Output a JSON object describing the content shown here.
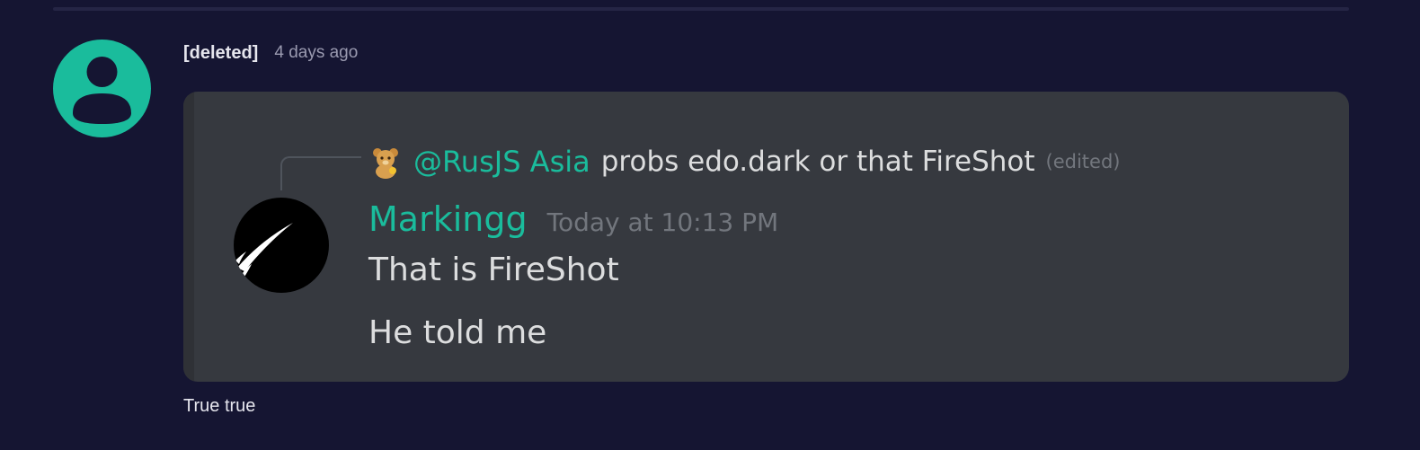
{
  "comment": {
    "author": "[deleted]",
    "time": "4 days ago",
    "avatar_icon": "user-silhouette-icon",
    "avatar_color": "#1abc9c",
    "text": "True true"
  },
  "screenshot": {
    "reply": {
      "emoji_icon": "bear-emoji-icon",
      "mention": "@RusJS Asia",
      "text": "probs edo.dark or that FireShot",
      "edited": "(edited)"
    },
    "message": {
      "author": "Markingg",
      "time": "Today at 10:13 PM",
      "lines": [
        "That is FireShot",
        "He told me"
      ]
    },
    "accent_color": "#1abc9c"
  }
}
